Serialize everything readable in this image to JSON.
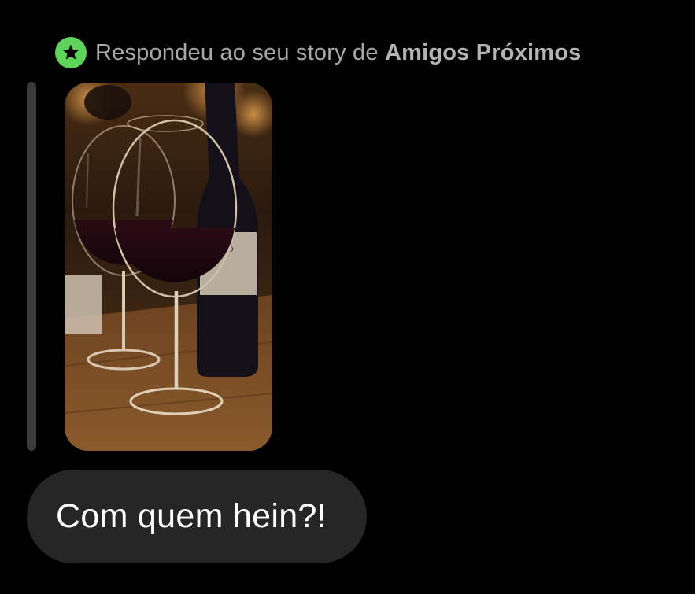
{
  "reply_header": {
    "prefix": "Respondeu ao seu story de",
    "list_name": "Amigos Próximos",
    "badge_icon": "star-icon",
    "badge_color": "#5ed35a"
  },
  "story_preview": {
    "subject": "two glasses of red wine next to a wine bottle",
    "bottle_label": "NTO",
    "accent_color": "#b57a3c"
  },
  "message": {
    "text": "Com quem hein?!",
    "bubble_color": "#262626",
    "text_color": "#ffffff"
  }
}
